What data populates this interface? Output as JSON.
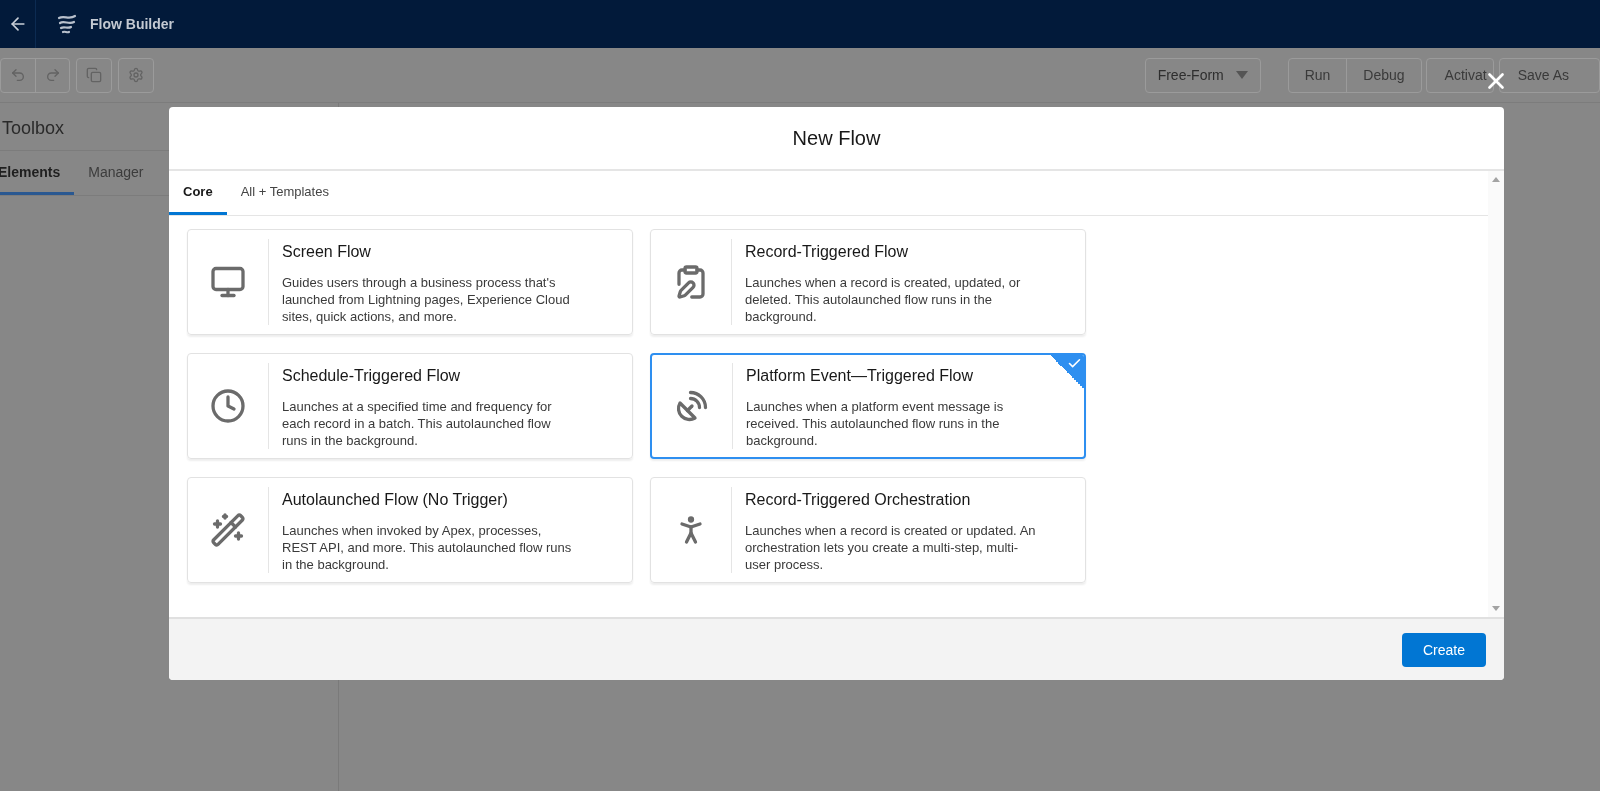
{
  "app": {
    "title": "Flow Builder"
  },
  "toolbar": {
    "layout_menu": "Free-Form",
    "run_group": [
      "Run",
      "Debug"
    ],
    "buttons": [
      "Activat",
      "Save As"
    ]
  },
  "toolbox": {
    "title": "Toolbox",
    "tabs": [
      {
        "label": "Elements",
        "selected": true
      },
      {
        "label": "Manager",
        "selected": false
      }
    ]
  },
  "modal": {
    "title": "New Flow",
    "tabs": [
      {
        "label": "Core",
        "selected": true
      },
      {
        "label": "All + Templates",
        "selected": false
      }
    ],
    "options": [
      {
        "kind": "screen",
        "title": "Screen Flow",
        "description": "Guides users through a business process that's launched from Lightning pages, Experience Cloud sites, quick actions, and more.",
        "selected": false
      },
      {
        "kind": "record",
        "title": "Record-Triggered Flow",
        "description": "Launches when a record is created, updated, or deleted. This autolaunched flow runs in the background.",
        "selected": false
      },
      {
        "kind": "schedule",
        "title": "Schedule-Triggered Flow",
        "description": "Launches at a specified time and frequency for each record in a batch. This autolaunched flow runs in the background.",
        "selected": false
      },
      {
        "kind": "event",
        "title": "Platform Event—Triggered Flow",
        "description": "Launches when a platform event message is received. This autolaunched flow runs in the background.",
        "selected": true
      },
      {
        "kind": "auto",
        "title": "Autolaunched Flow (No Trigger)",
        "description": "Launches when invoked by Apex, processes, REST API, and more. This autolaunched flow runs in the background.",
        "selected": false
      },
      {
        "kind": "orchestration",
        "title": "Record-Triggered Orchestration",
        "description": "Launches when a record is created or updated. An orchestration lets you create a multi-step, multi-user process.",
        "selected": false
      }
    ],
    "create_button": "Create"
  }
}
